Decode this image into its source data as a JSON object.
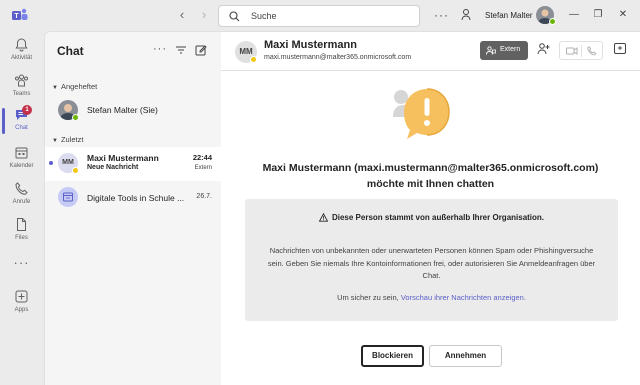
{
  "titlebar": {
    "search_placeholder": "Suche",
    "user_name": "Stefan Malter"
  },
  "rail": {
    "items": [
      {
        "label": "Aktivität",
        "icon": "bell-icon"
      },
      {
        "label": "Teams",
        "icon": "teams-icon"
      },
      {
        "label": "Chat",
        "icon": "chat-icon",
        "badge": "1",
        "active": true
      },
      {
        "label": "Kalender",
        "icon": "calendar-icon"
      },
      {
        "label": "Anrufe",
        "icon": "phone-icon"
      },
      {
        "label": "Files",
        "icon": "file-icon"
      },
      {
        "label": "",
        "icon": "more-icon"
      },
      {
        "label": "Apps",
        "icon": "apps-icon"
      }
    ]
  },
  "chatlist": {
    "title": "Chat",
    "pinned_header": "Angeheftet",
    "recent_header": "Zuletzt",
    "pinned": [
      {
        "name": "Stefan Malter (Sie)"
      }
    ],
    "recent": [
      {
        "initials": "MM",
        "name": "Maxi Mustermann",
        "preview": "Neue Nachricht",
        "time": "22:44",
        "tag": "Extern"
      },
      {
        "name": "Digitale Tools in Schule ...",
        "time": "26.7."
      }
    ]
  },
  "main": {
    "initials": "MM",
    "name": "Maxi Mustermann",
    "email": "maxi.mustermann@malter365.onmicrosoft.com",
    "extern_label": "Extern",
    "request_line1": "Maxi Mustermann (maxi.mustermann@malter365.onmicrosoft.com)",
    "request_line2": "möchte mit Ihnen chatten",
    "warning_title": "Diese Person stammt von außerhalb Ihrer Organisation.",
    "warning_text": "Nachrichten von unbekannten oder unerwarteten Personen können Spam oder Phishingversuche sein. Geben Sie niemals Ihre Kontoinformationen frei, oder autorisieren Sie Anmeldeanfragen über Chat.",
    "safe_prefix": "Um sicher zu sein, ",
    "safe_link": "Vorschau ihrer Nachrichten anzeigen.",
    "block_label": "Blockieren",
    "accept_label": "Annehmen"
  },
  "colors": {
    "brand": "#5b5fc7",
    "badge": "#c4314b",
    "online": "#6bb700",
    "warning": "#f2c811",
    "extern_bg": "#616161"
  }
}
